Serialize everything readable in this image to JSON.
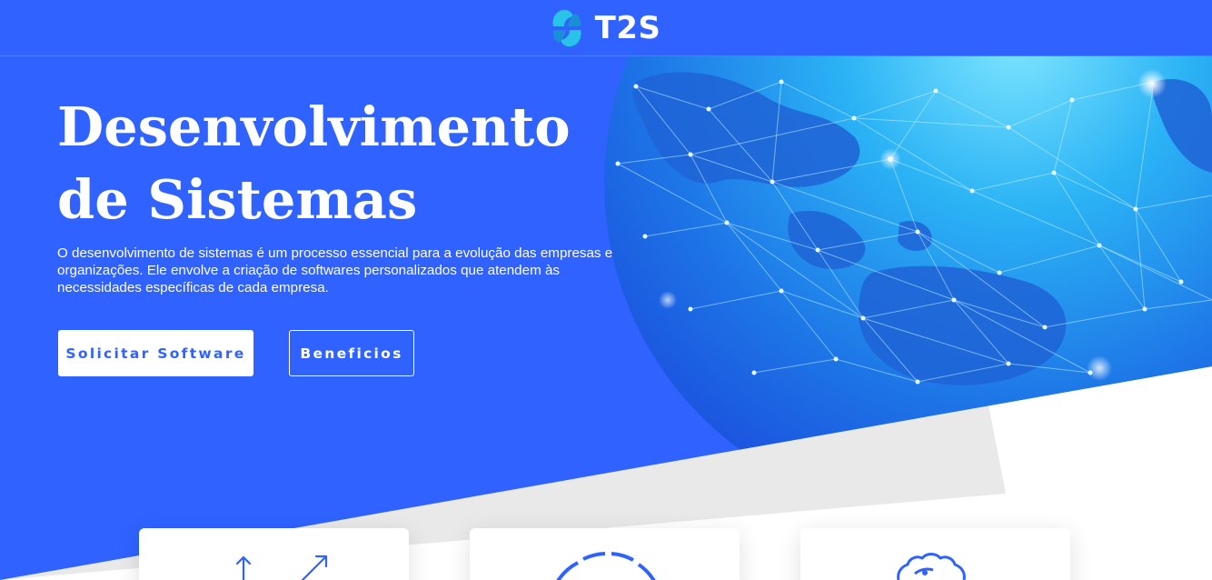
{
  "header": {
    "brand_name": "T2S",
    "logo_icon": "t2s-logo-icon"
  },
  "hero": {
    "title_line1": "Desenvolvimento",
    "title_line2": "de Sistemas",
    "description": "O desenvolvimento de sistemas é um processo essencial para a evolução das empresas e organizações. Ele envolve a criação de softwares personalizados que atendem às necessidades específicas de cada empresa.",
    "primary_button_label": "Solicitar Software",
    "secondary_button_label": "Beneficios",
    "background_image": "network-globe-image"
  },
  "cards": [
    {
      "icon": "growth-arrows-icon"
    },
    {
      "icon": "circular-segments-icon"
    },
    {
      "icon": "gear-badge-icon"
    }
  ],
  "colors": {
    "primary_blue": "#2f62ff",
    "white": "#ffffff",
    "grey_band": "#e9e9e9"
  }
}
